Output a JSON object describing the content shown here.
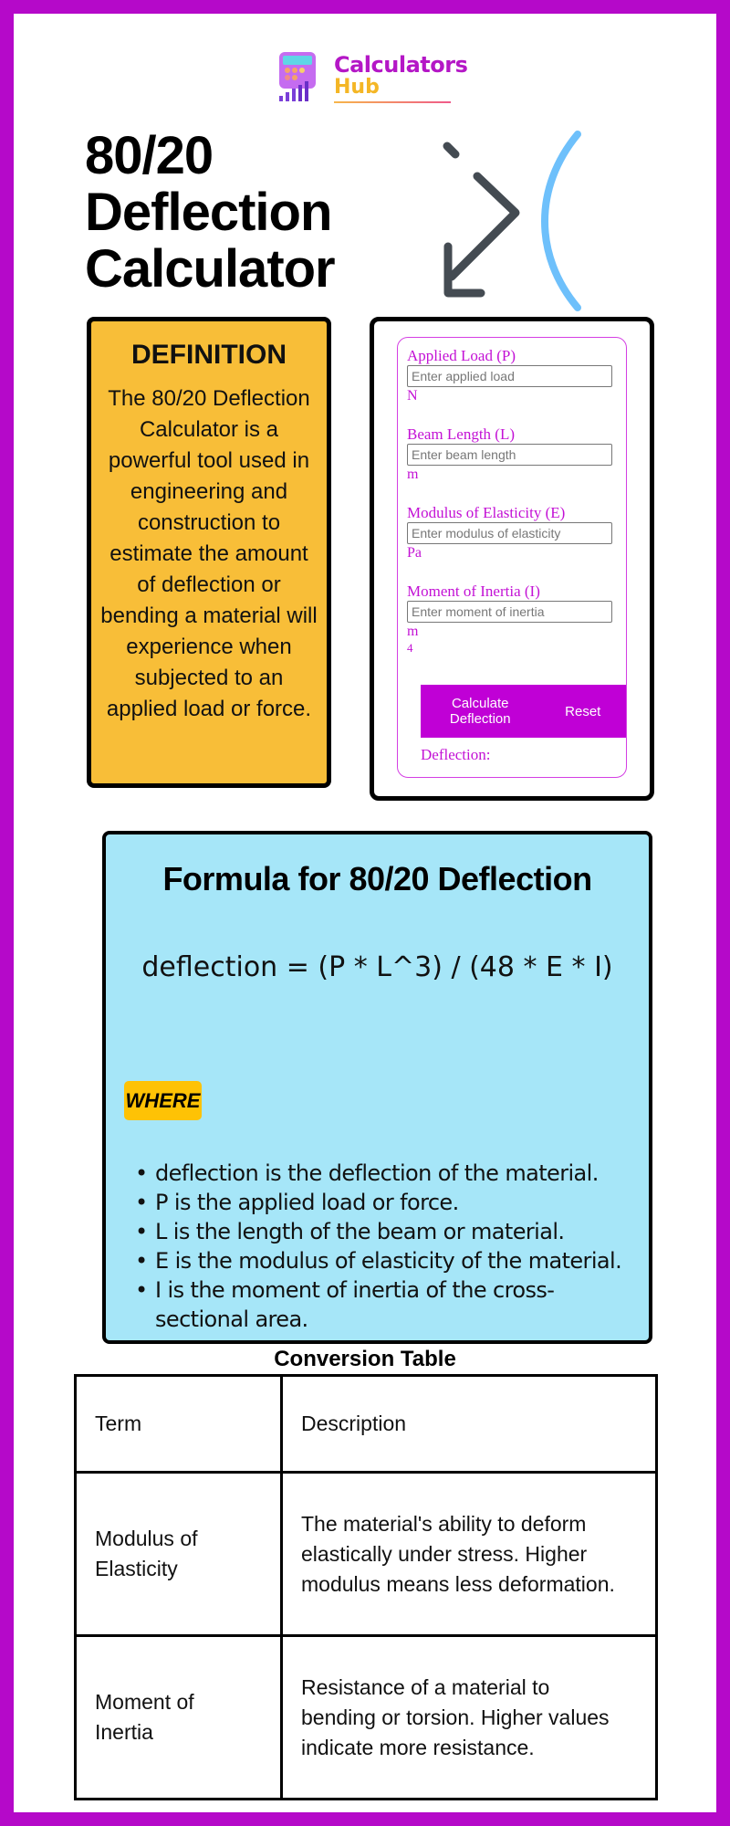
{
  "brand": {
    "name_line1": "Calculators",
    "name_line2": "Hub",
    "colors": {
      "frame": "#b509c9",
      "brand_purple": "#b417c6",
      "brand_yellow": "#f4b625"
    }
  },
  "header": {
    "title": "80/20 Deflection Calculator",
    "hero_icon": "deflection-arrow-icon"
  },
  "definition": {
    "title": "DEFINITION",
    "body": "The 80/20 Deflection Calculator is a powerful tool used in engineering and construction to estimate the amount of deflection or bending a material will experience when subjected to an applied load or force.",
    "bg_color": "#f8be38"
  },
  "calculator": {
    "accent_color": "#c000d6",
    "fields": [
      {
        "label": "Applied Load (P)",
        "placeholder": "Enter applied load",
        "value": "",
        "unit": "N",
        "unit_sup": ""
      },
      {
        "label": "Beam Length (L)",
        "placeholder": "Enter beam length",
        "value": "",
        "unit": "m",
        "unit_sup": ""
      },
      {
        "label": "Modulus of Elasticity (E)",
        "placeholder": "Enter modulus of elasticity",
        "value": "",
        "unit": "Pa",
        "unit_sup": ""
      },
      {
        "label": "Moment of Inertia (I)",
        "placeholder": "Enter moment of inertia",
        "value": "",
        "unit": "m",
        "unit_sup": "4"
      }
    ],
    "calculate_label": "Calculate Deflection",
    "reset_label": "Reset",
    "result_label": "Deflection:"
  },
  "formula": {
    "title": "Formula for 80/20 Deflection",
    "equation": "deflection = (P * L^3) / (48 * E * I)",
    "where_label": "WHERE",
    "variables": [
      "deflection is the deflection of the material.",
      "P is the applied load or force.",
      "L is the length of the beam or material.",
      "E is the modulus of elasticity of the material.",
      "I is the moment of inertia of the cross-sectional area."
    ],
    "bg_color": "#a6e6f8"
  },
  "conversion_table": {
    "title": "Conversion Table",
    "headers": [
      "Term",
      "Description"
    ],
    "rows": [
      {
        "term": "Modulus of Elasticity",
        "description": "The material's ability to deform elastically under stress. Higher modulus means less deformation."
      },
      {
        "term": "Moment of Inertia",
        "description": "Resistance of a material to bending or torsion. Higher values indicate more resistance."
      }
    ]
  }
}
